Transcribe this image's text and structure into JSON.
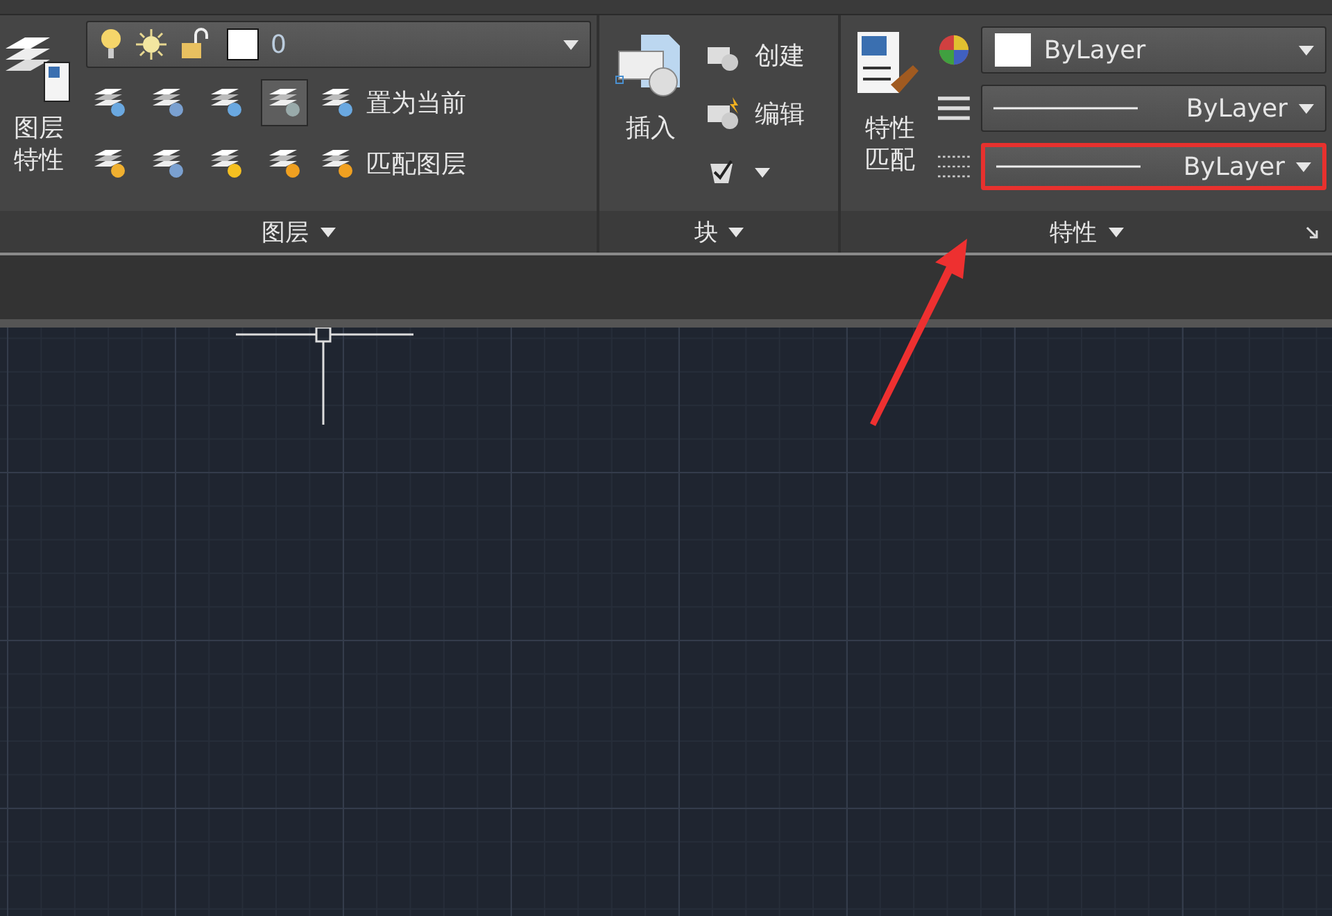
{
  "layers_panel": {
    "properties_button": {
      "label": "图层特性"
    },
    "layer_dropdown": {
      "value": "0"
    },
    "tool_rows": [
      {
        "icons": [
          {
            "selected": false
          },
          {
            "selected": false
          },
          {
            "selected": false
          },
          {
            "selected": true
          }
        ],
        "action": "置为当前"
      },
      {
        "icons": [
          {
            "selected": false
          },
          {
            "selected": false
          },
          {
            "selected": false
          },
          {
            "selected": false
          }
        ],
        "action": "匹配图层"
      }
    ],
    "title": "图层"
  },
  "block_panel": {
    "insert_button": {
      "label": "插入"
    },
    "actions": [
      {
        "kind": "text",
        "label": "创建"
      },
      {
        "kind": "text",
        "label": "编辑"
      },
      {
        "kind": "menu"
      }
    ],
    "title": "块"
  },
  "properties_panel": {
    "match_button": {
      "label": "特性匹配"
    },
    "dropdowns": [
      {
        "kind": "color",
        "value": "ByLayer",
        "highlighted": false
      },
      {
        "kind": "linetype",
        "value": "ByLayer",
        "highlighted": false
      },
      {
        "kind": "lineweight",
        "value": "ByLayer",
        "highlighted": true
      }
    ],
    "title": "特性"
  }
}
